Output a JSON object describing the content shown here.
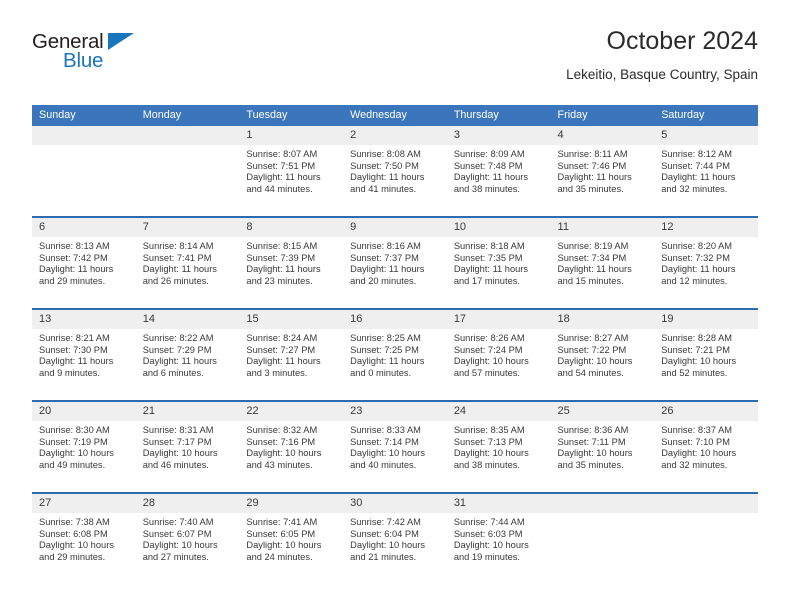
{
  "brand": {
    "name_top": "General",
    "name_bottom": "Blue",
    "color_dark": "#231f20",
    "color_blue": "#1b75bb"
  },
  "header": {
    "title": "October 2024",
    "subtitle": "Lekeitio, Basque Country, Spain"
  },
  "theme": {
    "header_bg": "#3b76bc",
    "row_divider": "#2e6bb0",
    "daynum_band": "#efefef",
    "text": "#3a3a3a"
  },
  "weekday_headers": [
    "Sunday",
    "Monday",
    "Tuesday",
    "Wednesday",
    "Thursday",
    "Friday",
    "Saturday"
  ],
  "weeks": [
    [
      {
        "day": "",
        "sunrise": "",
        "sunset": "",
        "daylight1": "",
        "daylight2": ""
      },
      {
        "day": "",
        "sunrise": "",
        "sunset": "",
        "daylight1": "",
        "daylight2": ""
      },
      {
        "day": "1",
        "sunrise": "Sunrise: 8:07 AM",
        "sunset": "Sunset: 7:51 PM",
        "daylight1": "Daylight: 11 hours",
        "daylight2": "and 44 minutes."
      },
      {
        "day": "2",
        "sunrise": "Sunrise: 8:08 AM",
        "sunset": "Sunset: 7:50 PM",
        "daylight1": "Daylight: 11 hours",
        "daylight2": "and 41 minutes."
      },
      {
        "day": "3",
        "sunrise": "Sunrise: 8:09 AM",
        "sunset": "Sunset: 7:48 PM",
        "daylight1": "Daylight: 11 hours",
        "daylight2": "and 38 minutes."
      },
      {
        "day": "4",
        "sunrise": "Sunrise: 8:11 AM",
        "sunset": "Sunset: 7:46 PM",
        "daylight1": "Daylight: 11 hours",
        "daylight2": "and 35 minutes."
      },
      {
        "day": "5",
        "sunrise": "Sunrise: 8:12 AM",
        "sunset": "Sunset: 7:44 PM",
        "daylight1": "Daylight: 11 hours",
        "daylight2": "and 32 minutes."
      }
    ],
    [
      {
        "day": "6",
        "sunrise": "Sunrise: 8:13 AM",
        "sunset": "Sunset: 7:42 PM",
        "daylight1": "Daylight: 11 hours",
        "daylight2": "and 29 minutes."
      },
      {
        "day": "7",
        "sunrise": "Sunrise: 8:14 AM",
        "sunset": "Sunset: 7:41 PM",
        "daylight1": "Daylight: 11 hours",
        "daylight2": "and 26 minutes."
      },
      {
        "day": "8",
        "sunrise": "Sunrise: 8:15 AM",
        "sunset": "Sunset: 7:39 PM",
        "daylight1": "Daylight: 11 hours",
        "daylight2": "and 23 minutes."
      },
      {
        "day": "9",
        "sunrise": "Sunrise: 8:16 AM",
        "sunset": "Sunset: 7:37 PM",
        "daylight1": "Daylight: 11 hours",
        "daylight2": "and 20 minutes."
      },
      {
        "day": "10",
        "sunrise": "Sunrise: 8:18 AM",
        "sunset": "Sunset: 7:35 PM",
        "daylight1": "Daylight: 11 hours",
        "daylight2": "and 17 minutes."
      },
      {
        "day": "11",
        "sunrise": "Sunrise: 8:19 AM",
        "sunset": "Sunset: 7:34 PM",
        "daylight1": "Daylight: 11 hours",
        "daylight2": "and 15 minutes."
      },
      {
        "day": "12",
        "sunrise": "Sunrise: 8:20 AM",
        "sunset": "Sunset: 7:32 PM",
        "daylight1": "Daylight: 11 hours",
        "daylight2": "and 12 minutes."
      }
    ],
    [
      {
        "day": "13",
        "sunrise": "Sunrise: 8:21 AM",
        "sunset": "Sunset: 7:30 PM",
        "daylight1": "Daylight: 11 hours",
        "daylight2": "and 9 minutes."
      },
      {
        "day": "14",
        "sunrise": "Sunrise: 8:22 AM",
        "sunset": "Sunset: 7:29 PM",
        "daylight1": "Daylight: 11 hours",
        "daylight2": "and 6 minutes."
      },
      {
        "day": "15",
        "sunrise": "Sunrise: 8:24 AM",
        "sunset": "Sunset: 7:27 PM",
        "daylight1": "Daylight: 11 hours",
        "daylight2": "and 3 minutes."
      },
      {
        "day": "16",
        "sunrise": "Sunrise: 8:25 AM",
        "sunset": "Sunset: 7:25 PM",
        "daylight1": "Daylight: 11 hours",
        "daylight2": "and 0 minutes."
      },
      {
        "day": "17",
        "sunrise": "Sunrise: 8:26 AM",
        "sunset": "Sunset: 7:24 PM",
        "daylight1": "Daylight: 10 hours",
        "daylight2": "and 57 minutes."
      },
      {
        "day": "18",
        "sunrise": "Sunrise: 8:27 AM",
        "sunset": "Sunset: 7:22 PM",
        "daylight1": "Daylight: 10 hours",
        "daylight2": "and 54 minutes."
      },
      {
        "day": "19",
        "sunrise": "Sunrise: 8:28 AM",
        "sunset": "Sunset: 7:21 PM",
        "daylight1": "Daylight: 10 hours",
        "daylight2": "and 52 minutes."
      }
    ],
    [
      {
        "day": "20",
        "sunrise": "Sunrise: 8:30 AM",
        "sunset": "Sunset: 7:19 PM",
        "daylight1": "Daylight: 10 hours",
        "daylight2": "and 49 minutes."
      },
      {
        "day": "21",
        "sunrise": "Sunrise: 8:31 AM",
        "sunset": "Sunset: 7:17 PM",
        "daylight1": "Daylight: 10 hours",
        "daylight2": "and 46 minutes."
      },
      {
        "day": "22",
        "sunrise": "Sunrise: 8:32 AM",
        "sunset": "Sunset: 7:16 PM",
        "daylight1": "Daylight: 10 hours",
        "daylight2": "and 43 minutes."
      },
      {
        "day": "23",
        "sunrise": "Sunrise: 8:33 AM",
        "sunset": "Sunset: 7:14 PM",
        "daylight1": "Daylight: 10 hours",
        "daylight2": "and 40 minutes."
      },
      {
        "day": "24",
        "sunrise": "Sunrise: 8:35 AM",
        "sunset": "Sunset: 7:13 PM",
        "daylight1": "Daylight: 10 hours",
        "daylight2": "and 38 minutes."
      },
      {
        "day": "25",
        "sunrise": "Sunrise: 8:36 AM",
        "sunset": "Sunset: 7:11 PM",
        "daylight1": "Daylight: 10 hours",
        "daylight2": "and 35 minutes."
      },
      {
        "day": "26",
        "sunrise": "Sunrise: 8:37 AM",
        "sunset": "Sunset: 7:10 PM",
        "daylight1": "Daylight: 10 hours",
        "daylight2": "and 32 minutes."
      }
    ],
    [
      {
        "day": "27",
        "sunrise": "Sunrise: 7:38 AM",
        "sunset": "Sunset: 6:08 PM",
        "daylight1": "Daylight: 10 hours",
        "daylight2": "and 29 minutes."
      },
      {
        "day": "28",
        "sunrise": "Sunrise: 7:40 AM",
        "sunset": "Sunset: 6:07 PM",
        "daylight1": "Daylight: 10 hours",
        "daylight2": "and 27 minutes."
      },
      {
        "day": "29",
        "sunrise": "Sunrise: 7:41 AM",
        "sunset": "Sunset: 6:05 PM",
        "daylight1": "Daylight: 10 hours",
        "daylight2": "and 24 minutes."
      },
      {
        "day": "30",
        "sunrise": "Sunrise: 7:42 AM",
        "sunset": "Sunset: 6:04 PM",
        "daylight1": "Daylight: 10 hours",
        "daylight2": "and 21 minutes."
      },
      {
        "day": "31",
        "sunrise": "Sunrise: 7:44 AM",
        "sunset": "Sunset: 6:03 PM",
        "daylight1": "Daylight: 10 hours",
        "daylight2": "and 19 minutes."
      },
      {
        "day": "",
        "sunrise": "",
        "sunset": "",
        "daylight1": "",
        "daylight2": ""
      },
      {
        "day": "",
        "sunrise": "",
        "sunset": "",
        "daylight1": "",
        "daylight2": ""
      }
    ]
  ]
}
